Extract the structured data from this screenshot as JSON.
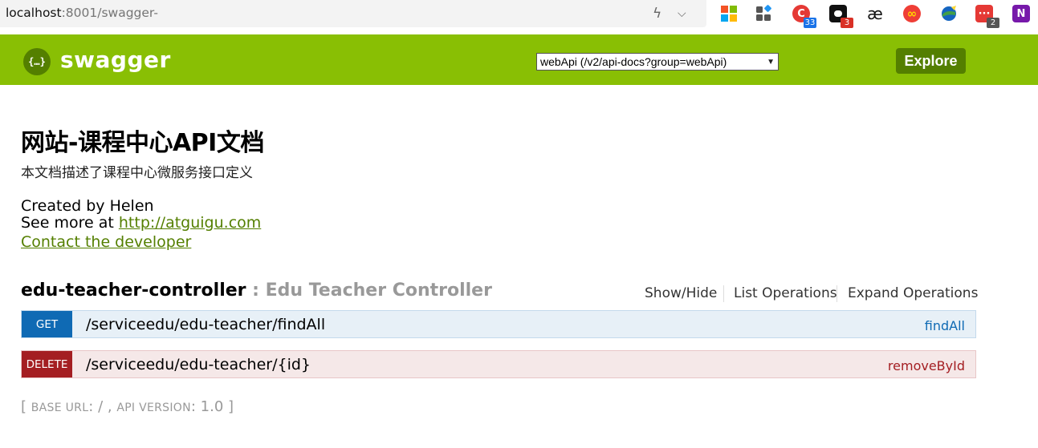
{
  "browser": {
    "url_host": "localhost",
    "url_rest": ":8001/swagger-",
    "extensions": [
      {
        "name": "windows-grid-icon",
        "color": "#f35325"
      },
      {
        "name": "apps-grid-icon",
        "color": "#444444"
      },
      {
        "name": "red-c-extension-icon",
        "color": "#e53935",
        "badge": "33",
        "badge_color": "#1a73e8"
      },
      {
        "name": "black-cloud-extension-icon",
        "color": "#111111",
        "badge": "3",
        "badge_color": "#d93025"
      },
      {
        "name": "ae-extension-icon",
        "color": "#ffffff",
        "glyph": "æ"
      },
      {
        "name": "infinity-extension-icon",
        "color": "#ef3e36"
      },
      {
        "name": "globe-extension-icon",
        "color": "#2e7d32"
      },
      {
        "name": "red-dots-extension-icon",
        "color": "#e53935",
        "badge": "2",
        "badge_color": "#555555"
      },
      {
        "name": "onenote-icon",
        "color": "#7719aa",
        "glyph": "N"
      }
    ]
  },
  "header": {
    "logo_glyph": "{…}",
    "logo_text": "swagger",
    "spec_selected": "webApi (/v2/api-docs?group=webApi)",
    "explore_label": "Explore",
    "color": "#89bf04",
    "dark_color": "#547f00"
  },
  "info": {
    "title": "网站-课程中心API文档",
    "description": "本文档描述了课程中心微服务接口定义",
    "created_by": "Created by Helen",
    "see_more_prefix": "See more at ",
    "see_more_link": "http://atguigu.com",
    "contact": "Contact the developer"
  },
  "resource": {
    "name": "edu-teacher-controller",
    "description": " : Edu Teacher Controller",
    "show_hide": "Show/Hide",
    "list_operations": "List Operations",
    "expand_operations": "Expand Operations",
    "operations": [
      {
        "method": "GET",
        "path": "/serviceedu/edu-teacher/findAll",
        "nickname": "findAll"
      },
      {
        "method": "DELETE",
        "path": "/serviceedu/edu-teacher/{id}",
        "nickname": "removeById"
      }
    ]
  },
  "footer": {
    "open": "[ ",
    "base_url_label": "BASE URL",
    "base_url_value": ": / , ",
    "api_version_label": "API VERSION",
    "api_version_value": ": 1.0 ]"
  }
}
